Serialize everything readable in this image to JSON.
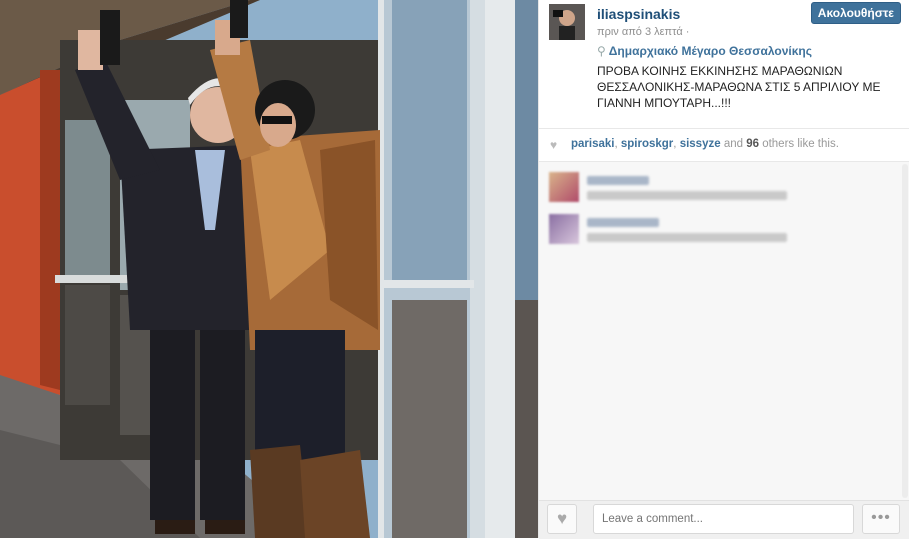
{
  "post": {
    "username": "iliaspsinakis",
    "follow_label": "Ακολουθήστε",
    "time": "πριν από 3 λεπτά ·",
    "location": "Δημαρχιακό Μέγαρο Θεσσαλονίκης",
    "caption": "ΠΡΟΒΑ ΚΟΙΝΗΣ ΕΚΚΙΝΗΣΗΣ ΜΑΡΑΘΩΝΙΩΝ ΘΕΣΣΑΛΟΝΙΚΗΣ-ΜΑΡΑΘΩΝΑ ΣΤΙΣ 5 ΑΠΡΙΛΙΟΥ ΜΕ ΓΙΑΝΝΗ ΜΠΟΥΤΑΡΗ...!!!"
  },
  "likes": {
    "users": [
      "parisaki",
      "spiroskgr",
      "sissyze"
    ],
    "sep1": ", ",
    "sep2": ", ",
    "and": " and ",
    "count": "96",
    "suffix": " others like this."
  },
  "footer": {
    "comment_placeholder": "Leave a comment...",
    "more_label": "•••"
  },
  "icons": {
    "like": "heart-icon",
    "location": "location-pin-icon",
    "more": "more-dots-icon"
  },
  "colors": {
    "accent": "#3f729b",
    "wall": "#c94e2d"
  }
}
